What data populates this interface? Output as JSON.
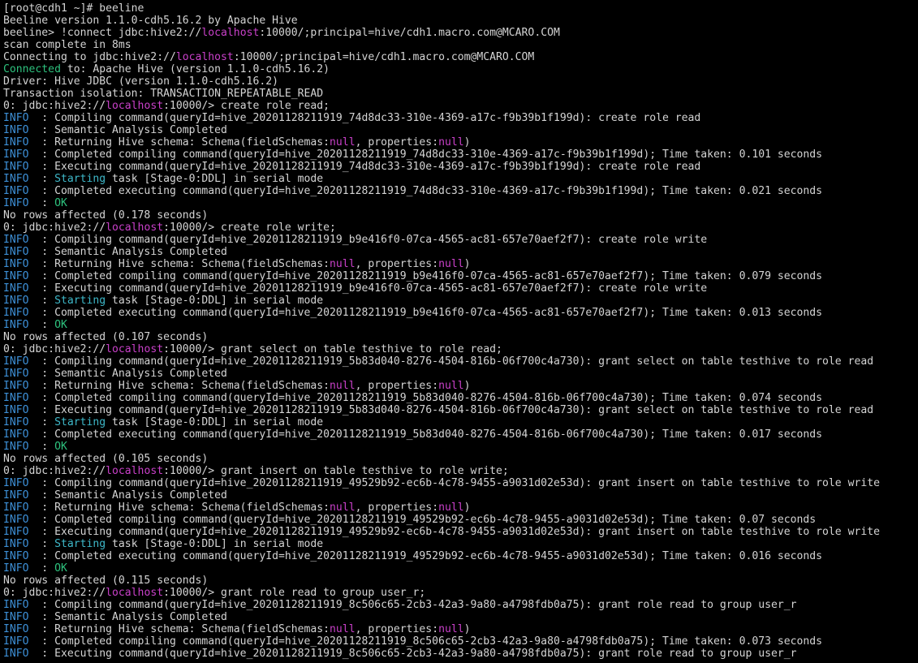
{
  "colors": {
    "background": "#000000",
    "default": "#d4d4d4",
    "info": "#3d8fd6",
    "localhost": "#c940c9",
    "null": "#c940c9",
    "starting": "#3eb8c9",
    "ok": "#2ec27e",
    "connected": "#2ec27e"
  },
  "terminal": {
    "lines": [
      [
        {
          "t": "[root@cdh1 ~]# beeline"
        }
      ],
      [
        {
          "t": "Beeline version 1.1.0-cdh5.16.2 by Apache Hive"
        }
      ],
      [
        {
          "t": "beeline> !connect jdbc:hive2://"
        },
        {
          "t": "localhost",
          "c": "localhost"
        },
        {
          "t": ":10000/;principal=hive/cdh1.macro.com@MCARO.COM"
        }
      ],
      [
        {
          "t": "scan complete in 8ms"
        }
      ],
      [
        {
          "t": "Connecting to jdbc:hive2://"
        },
        {
          "t": "localhost",
          "c": "localhost"
        },
        {
          "t": ":10000/;principal=hive/cdh1.macro.com@MCARO.COM"
        }
      ],
      [
        {
          "t": "Connected",
          "c": "connected"
        },
        {
          "t": " to: Apache Hive (version 1.1.0-cdh5.16.2)"
        }
      ],
      [
        {
          "t": "Driver: Hive JDBC (version 1.1.0-cdh5.16.2)"
        }
      ],
      [
        {
          "t": "Transaction isolation: TRANSACTION_REPEATABLE_READ"
        }
      ],
      [
        {
          "t": "0: jdbc:hive2://"
        },
        {
          "t": "localhost",
          "c": "localhost"
        },
        {
          "t": ":10000/> create role read;"
        }
      ],
      [
        {
          "t": "INFO ",
          "c": "info"
        },
        {
          "t": " : Compiling command(queryId=hive_20201128211919_74d8dc33-310e-4369-a17c-f9b39b1f199d): create role read"
        }
      ],
      [
        {
          "t": "INFO ",
          "c": "info"
        },
        {
          "t": " : Semantic Analysis Completed"
        }
      ],
      [
        {
          "t": "INFO ",
          "c": "info"
        },
        {
          "t": " : Returning Hive schema: Schema(fieldSchemas:"
        },
        {
          "t": "null",
          "c": "null"
        },
        {
          "t": ", properties:"
        },
        {
          "t": "null",
          "c": "null"
        },
        {
          "t": ")"
        }
      ],
      [
        {
          "t": "INFO ",
          "c": "info"
        },
        {
          "t": " : Completed compiling command(queryId=hive_20201128211919_74d8dc33-310e-4369-a17c-f9b39b1f199d); Time taken: 0.101 seconds"
        }
      ],
      [
        {
          "t": "INFO ",
          "c": "info"
        },
        {
          "t": " : Executing command(queryId=hive_20201128211919_74d8dc33-310e-4369-a17c-f9b39b1f199d): create role read"
        }
      ],
      [
        {
          "t": "INFO ",
          "c": "info"
        },
        {
          "t": " : "
        },
        {
          "t": "Starting",
          "c": "starting"
        },
        {
          "t": " task [Stage-0:DDL] in serial mode"
        }
      ],
      [
        {
          "t": "INFO ",
          "c": "info"
        },
        {
          "t": " : Completed executing command(queryId=hive_20201128211919_74d8dc33-310e-4369-a17c-f9b39b1f199d); Time taken: 0.021 seconds"
        }
      ],
      [
        {
          "t": "INFO ",
          "c": "info"
        },
        {
          "t": " : "
        },
        {
          "t": "OK",
          "c": "ok"
        }
      ],
      [
        {
          "t": "No rows affected (0.178 seconds)"
        }
      ],
      [
        {
          "t": "0: jdbc:hive2://"
        },
        {
          "t": "localhost",
          "c": "localhost"
        },
        {
          "t": ":10000/> create role write;"
        }
      ],
      [
        {
          "t": "INFO ",
          "c": "info"
        },
        {
          "t": " : Compiling command(queryId=hive_20201128211919_b9e416f0-07ca-4565-ac81-657e70aef2f7): create role write"
        }
      ],
      [
        {
          "t": "INFO ",
          "c": "info"
        },
        {
          "t": " : Semantic Analysis Completed"
        }
      ],
      [
        {
          "t": "INFO ",
          "c": "info"
        },
        {
          "t": " : Returning Hive schema: Schema(fieldSchemas:"
        },
        {
          "t": "null",
          "c": "null"
        },
        {
          "t": ", properties:"
        },
        {
          "t": "null",
          "c": "null"
        },
        {
          "t": ")"
        }
      ],
      [
        {
          "t": "INFO ",
          "c": "info"
        },
        {
          "t": " : Completed compiling command(queryId=hive_20201128211919_b9e416f0-07ca-4565-ac81-657e70aef2f7); Time taken: 0.079 seconds"
        }
      ],
      [
        {
          "t": "INFO ",
          "c": "info"
        },
        {
          "t": " : Executing command(queryId=hive_20201128211919_b9e416f0-07ca-4565-ac81-657e70aef2f7): create role write"
        }
      ],
      [
        {
          "t": "INFO ",
          "c": "info"
        },
        {
          "t": " : "
        },
        {
          "t": "Starting",
          "c": "starting"
        },
        {
          "t": " task [Stage-0:DDL] in serial mode"
        }
      ],
      [
        {
          "t": "INFO ",
          "c": "info"
        },
        {
          "t": " : Completed executing command(queryId=hive_20201128211919_b9e416f0-07ca-4565-ac81-657e70aef2f7); Time taken: 0.013 seconds"
        }
      ],
      [
        {
          "t": "INFO ",
          "c": "info"
        },
        {
          "t": " : "
        },
        {
          "t": "OK",
          "c": "ok"
        }
      ],
      [
        {
          "t": "No rows affected (0.107 seconds)"
        }
      ],
      [
        {
          "t": "0: jdbc:hive2://"
        },
        {
          "t": "localhost",
          "c": "localhost"
        },
        {
          "t": ":10000/> grant select on table testhive to role read;"
        }
      ],
      [
        {
          "t": "INFO ",
          "c": "info"
        },
        {
          "t": " : Compiling command(queryId=hive_20201128211919_5b83d040-8276-4504-816b-06f700c4a730): grant select on table testhive to role read"
        }
      ],
      [
        {
          "t": "INFO ",
          "c": "info"
        },
        {
          "t": " : Semantic Analysis Completed"
        }
      ],
      [
        {
          "t": "INFO ",
          "c": "info"
        },
        {
          "t": " : Returning Hive schema: Schema(fieldSchemas:"
        },
        {
          "t": "null",
          "c": "null"
        },
        {
          "t": ", properties:"
        },
        {
          "t": "null",
          "c": "null"
        },
        {
          "t": ")"
        }
      ],
      [
        {
          "t": "INFO ",
          "c": "info"
        },
        {
          "t": " : Completed compiling command(queryId=hive_20201128211919_5b83d040-8276-4504-816b-06f700c4a730); Time taken: 0.074 seconds"
        }
      ],
      [
        {
          "t": "INFO ",
          "c": "info"
        },
        {
          "t": " : Executing command(queryId=hive_20201128211919_5b83d040-8276-4504-816b-06f700c4a730): grant select on table testhive to role read"
        }
      ],
      [
        {
          "t": "INFO ",
          "c": "info"
        },
        {
          "t": " : "
        },
        {
          "t": "Starting",
          "c": "starting"
        },
        {
          "t": " task [Stage-0:DDL] in serial mode"
        }
      ],
      [
        {
          "t": "INFO ",
          "c": "info"
        },
        {
          "t": " : Completed executing command(queryId=hive_20201128211919_5b83d040-8276-4504-816b-06f700c4a730); Time taken: 0.017 seconds"
        }
      ],
      [
        {
          "t": "INFO ",
          "c": "info"
        },
        {
          "t": " : "
        },
        {
          "t": "OK",
          "c": "ok"
        }
      ],
      [
        {
          "t": "No rows affected (0.105 seconds)"
        }
      ],
      [
        {
          "t": "0: jdbc:hive2://"
        },
        {
          "t": "localhost",
          "c": "localhost"
        },
        {
          "t": ":10000/> grant insert on table testhive to role write;"
        }
      ],
      [
        {
          "t": "INFO ",
          "c": "info"
        },
        {
          "t": " : Compiling command(queryId=hive_20201128211919_49529b92-ec6b-4c78-9455-a9031d02e53d): grant insert on table testhive to role write"
        }
      ],
      [
        {
          "t": "INFO ",
          "c": "info"
        },
        {
          "t": " : Semantic Analysis Completed"
        }
      ],
      [
        {
          "t": "INFO ",
          "c": "info"
        },
        {
          "t": " : Returning Hive schema: Schema(fieldSchemas:"
        },
        {
          "t": "null",
          "c": "null"
        },
        {
          "t": ", properties:"
        },
        {
          "t": "null",
          "c": "null"
        },
        {
          "t": ")"
        }
      ],
      [
        {
          "t": "INFO ",
          "c": "info"
        },
        {
          "t": " : Completed compiling command(queryId=hive_20201128211919_49529b92-ec6b-4c78-9455-a9031d02e53d); Time taken: 0.07 seconds"
        }
      ],
      [
        {
          "t": "INFO ",
          "c": "info"
        },
        {
          "t": " : Executing command(queryId=hive_20201128211919_49529b92-ec6b-4c78-9455-a9031d02e53d): grant insert on table testhive to role write"
        }
      ],
      [
        {
          "t": "INFO ",
          "c": "info"
        },
        {
          "t": " : "
        },
        {
          "t": "Starting",
          "c": "starting"
        },
        {
          "t": " task [Stage-0:DDL] in serial mode"
        }
      ],
      [
        {
          "t": "INFO ",
          "c": "info"
        },
        {
          "t": " : Completed executing command(queryId=hive_20201128211919_49529b92-ec6b-4c78-9455-a9031d02e53d); Time taken: 0.016 seconds"
        }
      ],
      [
        {
          "t": "INFO ",
          "c": "info"
        },
        {
          "t": " : "
        },
        {
          "t": "OK",
          "c": "ok"
        }
      ],
      [
        {
          "t": "No rows affected (0.115 seconds)"
        }
      ],
      [
        {
          "t": "0: jdbc:hive2://"
        },
        {
          "t": "localhost",
          "c": "localhost"
        },
        {
          "t": ":10000/> grant role read to group user_r;"
        }
      ],
      [
        {
          "t": "INFO ",
          "c": "info"
        },
        {
          "t": " : Compiling command(queryId=hive_20201128211919_8c506c65-2cb3-42a3-9a80-a4798fdb0a75): grant role read to group user_r"
        }
      ],
      [
        {
          "t": "INFO ",
          "c": "info"
        },
        {
          "t": " : Semantic Analysis Completed"
        }
      ],
      [
        {
          "t": "INFO ",
          "c": "info"
        },
        {
          "t": " : Returning Hive schema: Schema(fieldSchemas:"
        },
        {
          "t": "null",
          "c": "null"
        },
        {
          "t": ", properties:"
        },
        {
          "t": "null",
          "c": "null"
        },
        {
          "t": ")"
        }
      ],
      [
        {
          "t": "INFO ",
          "c": "info"
        },
        {
          "t": " : Completed compiling command(queryId=hive_20201128211919_8c506c65-2cb3-42a3-9a80-a4798fdb0a75); Time taken: 0.073 seconds"
        }
      ],
      [
        {
          "t": "INFO ",
          "c": "info"
        },
        {
          "t": " : Executing command(queryId=hive_20201128211919_8c506c65-2cb3-42a3-9a80-a4798fdb0a75): grant role read to group user_r"
        }
      ]
    ]
  }
}
